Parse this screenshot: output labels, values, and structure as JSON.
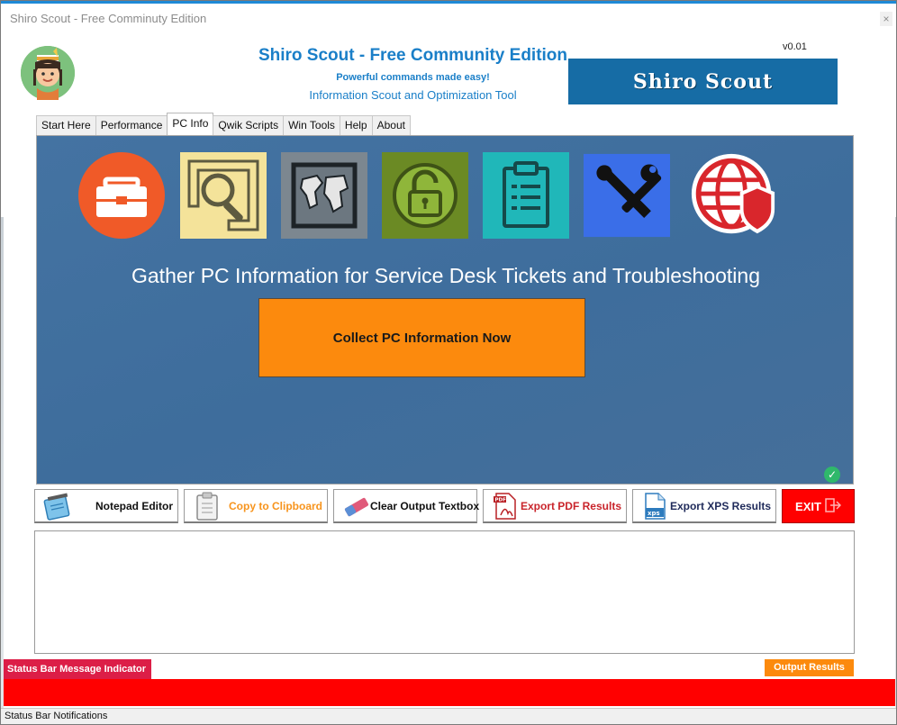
{
  "window": {
    "title": "Shiro Scout - Free Comminuty Edition",
    "close_glyph": "×"
  },
  "header": {
    "title": "Shiro Scout - Free Community Edition",
    "subtitle": "Powerful commands made easy!",
    "description": "Information Scout and Optimization Tool",
    "version": "v0.01",
    "logo_text": "Shiro Scout"
  },
  "tabs": [
    {
      "label": "Start Here"
    },
    {
      "label": "Performance"
    },
    {
      "label": "PC Info",
      "active": true
    },
    {
      "label": "Qwik Scripts"
    },
    {
      "label": "Win Tools"
    },
    {
      "label": "Help"
    },
    {
      "label": "About"
    }
  ],
  "panel": {
    "heading": "Gather PC Information for Service Desk Tickets and Troubleshooting",
    "collect_button": "Collect PC Information Now",
    "icons": [
      "briefcase-icon",
      "magnifier-icon",
      "world-map-icon",
      "padlock-icon",
      "clipboard-icon",
      "tools-icon",
      "globe-shield-icon"
    ],
    "status_glyph": "✓"
  },
  "toolbar": {
    "notepad": "Notepad Editor",
    "clipboard": "Copy to Clipboard",
    "clear": "Clear Output Textbox",
    "pdf": "Export PDF Results",
    "xps": "Export XPS Results",
    "exit": "EXIT",
    "pdf_badge": "PDF",
    "xps_badge": "xps"
  },
  "status": {
    "indicator": "Status Bar Message Indicator",
    "output_results": "Output Results",
    "notifications": "Status Bar Notifications"
  },
  "colors": {
    "accent_blue": "#1a7fc8",
    "panel_blue": "#4473a2",
    "orange": "#fc8a0d",
    "red": "#ff0000",
    "status_pink": "#dc1e47"
  }
}
